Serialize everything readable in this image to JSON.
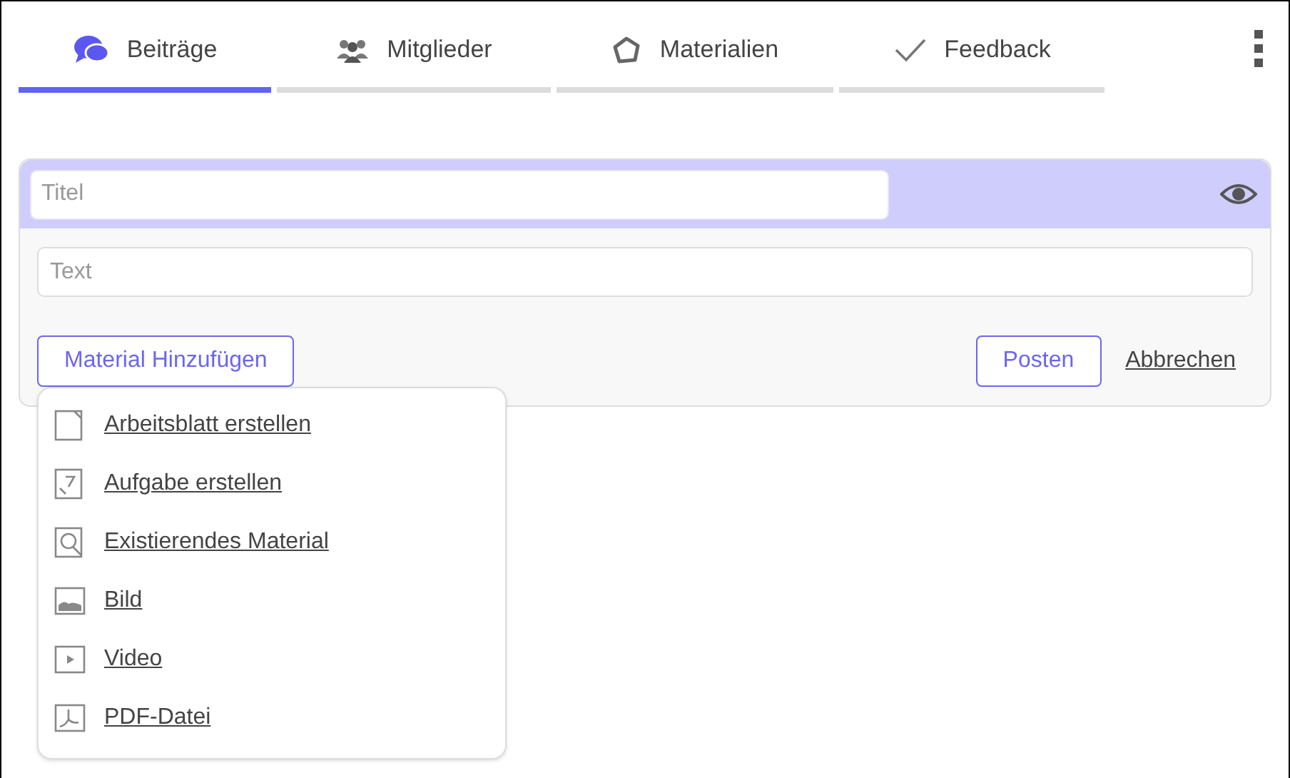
{
  "tabs": [
    {
      "label": "Beiträge",
      "selected": true,
      "kind": "chat"
    },
    {
      "label": "Mitglieder",
      "selected": false,
      "kind": "people"
    },
    {
      "label": "Materialien",
      "selected": false,
      "kind": "shape"
    },
    {
      "label": "Feedback",
      "selected": false,
      "kind": "check"
    }
  ],
  "post_form": {
    "title_field": {
      "placeholder": "Titel"
    },
    "text_field": {
      "placeholder": "Text"
    },
    "add_material_button": "Material Hinzufügen",
    "post_button": "Posten",
    "cancel_link": "Abbrechen"
  },
  "material_menu": [
    {
      "label": "Arbeitsblatt erstellen",
      "kind": "sheet"
    },
    {
      "label": "Aufgabe erstellen",
      "kind": "task"
    },
    {
      "label": "Existierendes Material",
      "kind": "search"
    },
    {
      "label": "Bild",
      "kind": "image"
    },
    {
      "label": "Video",
      "kind": "video"
    },
    {
      "label": "PDF-Datei",
      "kind": "pdf"
    }
  ]
}
